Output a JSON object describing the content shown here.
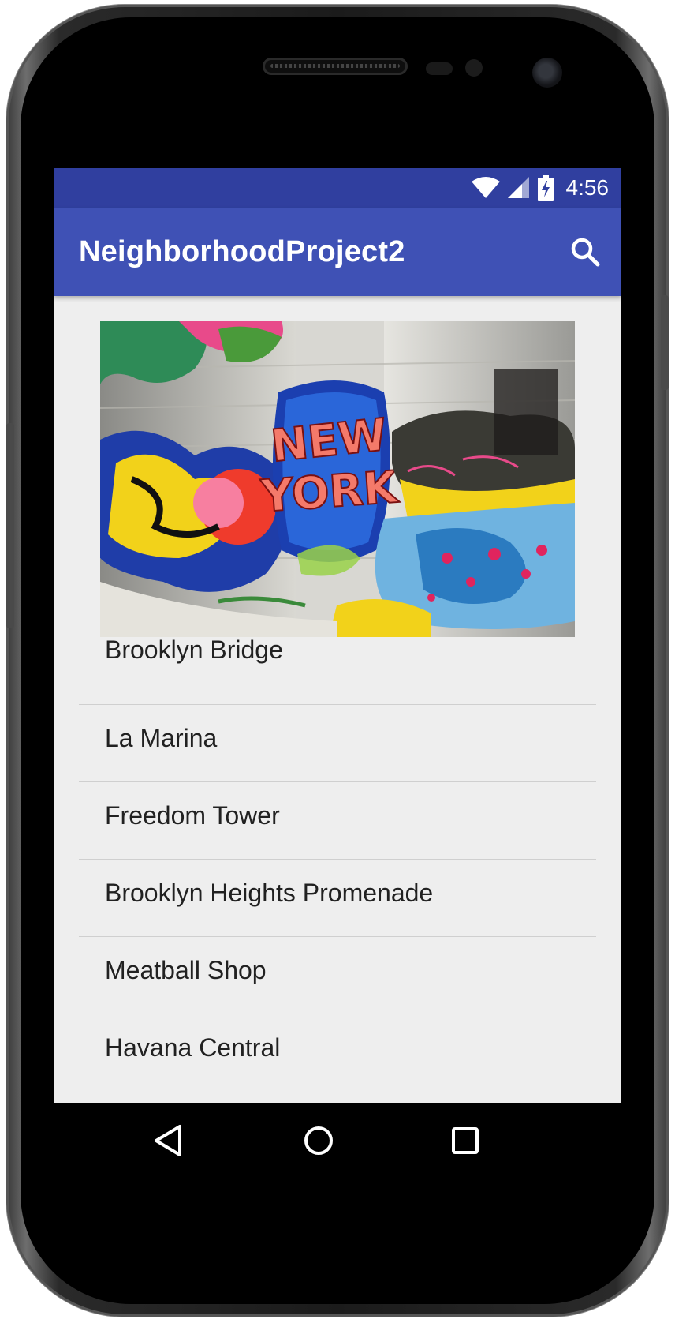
{
  "status_bar": {
    "time": "4:56",
    "icons": [
      "wifi-icon",
      "signal-icon",
      "battery-charging-icon"
    ]
  },
  "app_bar": {
    "title": "NeighborhoodProject2",
    "action_icon": "search-icon"
  },
  "hero_image": {
    "alt": "New York graffiti wall",
    "text": "NEW YORK"
  },
  "places": [
    {
      "label": "Brooklyn Bridge"
    },
    {
      "label": "La Marina"
    },
    {
      "label": "Freedom Tower"
    },
    {
      "label": "Brooklyn Heights Promenade"
    },
    {
      "label": "Meatball Shop"
    },
    {
      "label": "Havana Central"
    }
  ],
  "nav_bar": {
    "icons": [
      "back-icon",
      "home-icon",
      "recents-icon"
    ]
  },
  "colors": {
    "status_bar": "#303f9f",
    "app_bar": "#3f51b5",
    "content_bg": "#eeeeee"
  }
}
